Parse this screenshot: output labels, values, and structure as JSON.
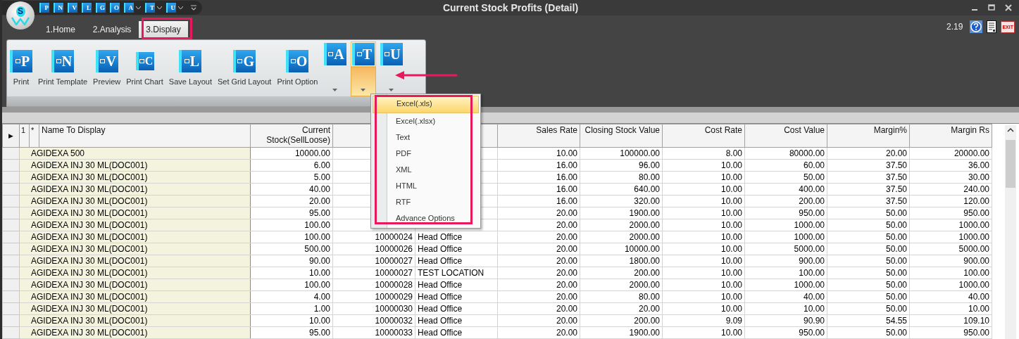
{
  "window": {
    "title": "Current Stock Profits (Detail)"
  },
  "logo": {
    "letter": "S"
  },
  "quick_access": [
    {
      "glyph": "P",
      "dropdown": false
    },
    {
      "glyph": "N",
      "dropdown": false
    },
    {
      "glyph": "V",
      "dropdown": false
    },
    {
      "glyph": "L",
      "dropdown": false
    },
    {
      "glyph": "G",
      "dropdown": false
    },
    {
      "glyph": "O",
      "dropdown": false
    },
    {
      "glyph": "A",
      "dropdown": true
    },
    {
      "glyph": "T",
      "dropdown": true
    },
    {
      "glyph": "U",
      "dropdown": true
    }
  ],
  "tabs": [
    {
      "label": "1.Home",
      "selected": false
    },
    {
      "label": "2.Analysis",
      "selected": false
    },
    {
      "label": "3.Display",
      "selected": true
    }
  ],
  "version": "2.19",
  "exit_label": "EXIT",
  "ribbon": {
    "items": [
      {
        "kind": "large",
        "glyph": "P",
        "label": "Print"
      },
      {
        "kind": "large",
        "glyph": "N",
        "label": "Print Template"
      },
      {
        "kind": "large",
        "glyph": "V",
        "label": "Preview"
      },
      {
        "kind": "large",
        "glyph": "C",
        "label": "Print Chart"
      },
      {
        "kind": "large",
        "glyph": "L",
        "label": "Save Layout"
      },
      {
        "kind": "large",
        "glyph": "G",
        "label": "Set Grid Layout"
      },
      {
        "kind": "large",
        "glyph": "O",
        "label": "Print Option"
      },
      {
        "kind": "split",
        "glyph": "A",
        "open": false
      },
      {
        "kind": "split",
        "glyph": "T",
        "open": true
      },
      {
        "kind": "split",
        "glyph": "U",
        "open": false
      }
    ]
  },
  "export_menu": {
    "items": [
      {
        "label": "Excel(.xls)",
        "selected": true
      },
      {
        "label": "Excel(.xlsx)",
        "selected": false
      },
      {
        "label": "Text",
        "selected": false
      },
      {
        "label": "PDF",
        "selected": false
      },
      {
        "label": "XML",
        "selected": false
      },
      {
        "label": "HTML",
        "selected": false
      },
      {
        "label": "RTF",
        "selected": false
      },
      {
        "label": "Advance Options",
        "selected": false
      }
    ]
  },
  "table": {
    "row_marker": "▶",
    "lead_columns": [
      "1",
      "*"
    ],
    "columns": [
      "Name To Display",
      "Current Stock(SellLoose)",
      null,
      null,
      "Sales Rate",
      "Closing Stock Value",
      "Cost Rate",
      "Cost Value",
      "Margin%",
      "Margin Rs"
    ],
    "rows": [
      {
        "cells": [
          "AGIDEXA 500",
          "10000.00",
          null,
          null,
          "10.00",
          "100000.00",
          "8.00",
          "80000.00",
          "20.00",
          "20000.00"
        ]
      },
      {
        "cells": [
          "AGIDEXA INJ 30 ML(DOC001)",
          "6.00",
          null,
          null,
          "16.00",
          "96.00",
          "10.00",
          "60.00",
          "37.50",
          "36.00"
        ]
      },
      {
        "cells": [
          "AGIDEXA INJ 30 ML(DOC001)",
          "5.00",
          null,
          null,
          "16.00",
          "80.00",
          "10.00",
          "50.00",
          "37.50",
          "30.00"
        ]
      },
      {
        "cells": [
          "AGIDEXA INJ 30 ML(DOC001)",
          "40.00",
          null,
          null,
          "16.00",
          "640.00",
          "10.00",
          "400.00",
          "37.50",
          "240.00"
        ]
      },
      {
        "cells": [
          "AGIDEXA INJ 30 ML(DOC001)",
          "20.00",
          null,
          null,
          "16.00",
          "320.00",
          "10.00",
          "200.00",
          "37.50",
          "120.00"
        ]
      },
      {
        "cells": [
          "AGIDEXA INJ 30 ML(DOC001)",
          "95.00",
          null,
          null,
          "20.00",
          "1900.00",
          "10.00",
          "950.00",
          "50.00",
          "950.00"
        ]
      },
      {
        "cells": [
          "AGIDEXA INJ 30 ML(DOC001)",
          "100.00",
          null,
          null,
          "20.00",
          "2000.00",
          "10.00",
          "1000.00",
          "50.00",
          "1000.00"
        ]
      },
      {
        "cells": [
          "AGIDEXA INJ 30 ML(DOC001)",
          "100.00",
          "10000024",
          "Head Office",
          "20.00",
          "2000.00",
          "10.00",
          "1000.00",
          "50.00",
          "1000.00"
        ]
      },
      {
        "cells": [
          "AGIDEXA INJ 30 ML(DOC001)",
          "500.00",
          "10000026",
          "Head Office",
          "20.00",
          "10000.00",
          "10.00",
          "5000.00",
          "50.00",
          "5000.00"
        ]
      },
      {
        "cells": [
          "AGIDEXA INJ 30 ML(DOC001)",
          "90.00",
          "10000027",
          "Head Office",
          "20.00",
          "1800.00",
          "10.00",
          "900.00",
          "50.00",
          "900.00"
        ]
      },
      {
        "cells": [
          "AGIDEXA INJ 30 ML(DOC001)",
          "10.00",
          "10000027",
          "TEST LOCATION",
          "20.00",
          "200.00",
          "10.00",
          "100.00",
          "50.00",
          "100.00"
        ]
      },
      {
        "cells": [
          "AGIDEXA INJ 30 ML(DOC001)",
          "100.00",
          "10000028",
          "Head Office",
          "20.00",
          "2000.00",
          "10.00",
          "1000.00",
          "50.00",
          "1000.00"
        ]
      },
      {
        "cells": [
          "AGIDEXA INJ 30 ML(DOC001)",
          "4.00",
          "10000029",
          "Head Office",
          "20.00",
          "80.00",
          "10.00",
          "40.00",
          "50.00",
          "40.00"
        ]
      },
      {
        "cells": [
          "AGIDEXA INJ 30 ML(DOC001)",
          "1.00",
          "10000030",
          "Head Office",
          "20.00",
          "20.00",
          "10.00",
          "10.00",
          "50.00",
          "10.00"
        ]
      },
      {
        "cells": [
          "AGIDEXA INJ 30 ML(DOC001)",
          "10.00",
          "10000032",
          "Head Office",
          "20.00",
          "200.00",
          "9.09",
          "90.90",
          "54.55",
          "109.10"
        ]
      },
      {
        "cells": [
          "AGIDEXA INJ 30 ML(DOC001)",
          "95.00",
          "10000033",
          "Head Office",
          "20.00",
          "1900.00",
          "10.00",
          "950.00",
          "50.00",
          "950.00"
        ]
      }
    ]
  }
}
